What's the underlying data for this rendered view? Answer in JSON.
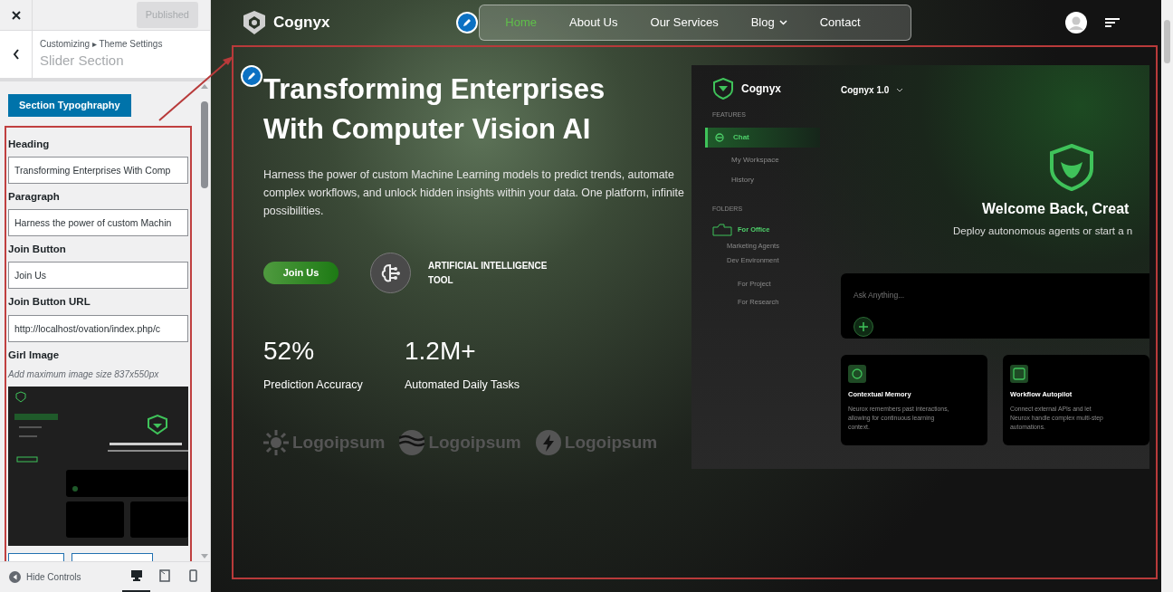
{
  "customizer": {
    "published_button": "Published",
    "breadcrumb": "Customizing ▸ Theme Settings",
    "title": "Slider Section",
    "section_button": "Section Typoghraphy",
    "fields": [
      {
        "label": "Heading",
        "value": "Transforming Enterprises With Comp"
      },
      {
        "label": "Paragraph",
        "value": "Harness the power of custom Machin"
      },
      {
        "label": "Join Button",
        "value": "Join Us"
      },
      {
        "label": "Join Button URL",
        "value": "http://localhost/ovation/index.php/c"
      }
    ],
    "image_field": {
      "label": "Girl Image",
      "hint": "Add maximum image size 837x550px"
    },
    "hide_controls": "Hide Controls",
    "devices": [
      {
        "kind": "desktop",
        "selected": true
      },
      {
        "kind": "tablet",
        "selected": false
      },
      {
        "kind": "mobile",
        "selected": false
      }
    ]
  },
  "site": {
    "brand": "Cognyx",
    "nav": [
      {
        "label": "Home",
        "selected": true,
        "dropdown": false
      },
      {
        "label": "About Us",
        "selected": false,
        "dropdown": false
      },
      {
        "label": "Our Services",
        "selected": false,
        "dropdown": false
      },
      {
        "label": "Blog",
        "selected": false,
        "dropdown": true
      },
      {
        "label": "Contact",
        "selected": false,
        "dropdown": false
      }
    ],
    "hero": {
      "heading": "Transforming Enterprises With Computer Vision AI",
      "paragraph": "Harness the power of custom Machine Learning models to predict trends, automate complex workflows, and unlock hidden insights within your data. One platform, infinite possibilities.",
      "button": "Join Us",
      "feature": "ARTIFICIAL INTELLIGENCE TOOL",
      "stats": [
        {
          "value": "52%",
          "label": "Prediction Accuracy"
        },
        {
          "value": "1.2M+",
          "label": "Automated Daily Tasks"
        }
      ],
      "logos": [
        {
          "kind": "sun",
          "text": "Logoipsum"
        },
        {
          "kind": "waves",
          "text": "Logoipsum"
        },
        {
          "kind": "bolt",
          "text": "Logoipsum"
        }
      ]
    },
    "mockup": {
      "brand": "Cognyx",
      "version": "Cognyx 1.0",
      "features_heading": "FEATURES",
      "features": [
        {
          "label": "Chat",
          "selected": true
        },
        {
          "label": "My Workspace",
          "selected": false
        },
        {
          "label": "History",
          "selected": false
        }
      ],
      "folders_heading": "FOLDERS",
      "folders": [
        {
          "label": "For Office",
          "selected": true,
          "children": [
            {
              "label": "Marketing Agents",
              "selected": false
            },
            {
              "label": "Dev Environment",
              "selected": false,
              "children": [
                {
                  "label": "For Project",
                  "selected": false
                },
                {
                  "label": "For Research",
                  "selected": false
                }
              ]
            }
          ]
        }
      ],
      "welcome": "Welcome Back, Creat",
      "subtitle": "Deploy autonomous agents or start a n",
      "ask_placeholder": "Ask Anything...",
      "cards": [
        {
          "kind": "circle",
          "title": "Contextual Memory",
          "text": "Neurox remembers past interactions, allowing for continuous learning context."
        },
        {
          "kind": "chip",
          "title": "Workflow Autopilot",
          "text": "Connect external APIs and let Neurox handle complex multi-step automations."
        }
      ]
    }
  }
}
